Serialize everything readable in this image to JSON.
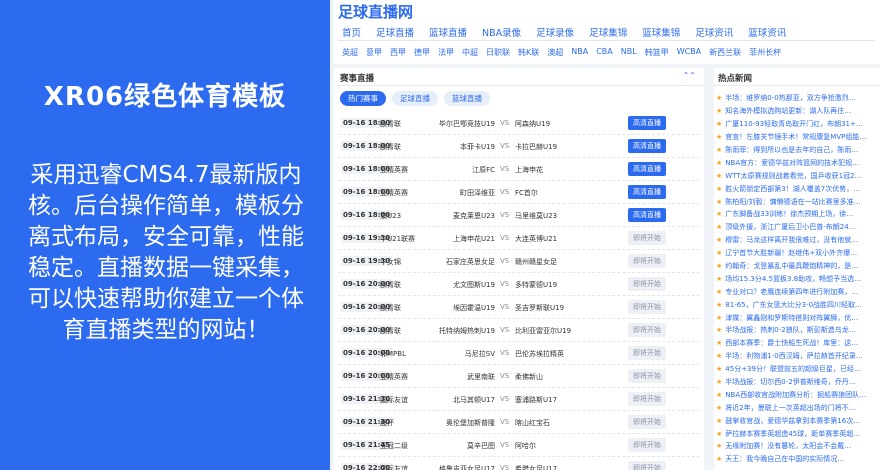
{
  "promo": {
    "title": "XR06绿色体育模板",
    "description": "采用迅睿CMS4.7最新版内核。后台操作简单，模板分离式布局，安全可靠，性能稳定。直播数据一键采集，可以快速帮助你建立一个体育直播类型的网站！"
  },
  "site": {
    "logo": "足球直播网",
    "nav_main": [
      "首页",
      "足球直播",
      "篮球直播",
      "NBA录像",
      "足球录像",
      "足球集锦",
      "篮球集锦",
      "足球资讯",
      "篮球资讯"
    ],
    "nav_sub": [
      "英超",
      "意甲",
      "西甲",
      "德甲",
      "法甲",
      "中超",
      "日职联",
      "韩K联",
      "澳超",
      "NBA",
      "CBA",
      "NBL",
      "韩篮甲",
      "WCBA",
      "新西兰联",
      "菲州长杯"
    ]
  },
  "schedule": {
    "title": "赛事直播",
    "collapse_icon": "double-chevron-up-icon",
    "tabs": [
      "热门赛事",
      "足球直播",
      "篮球直播"
    ],
    "rows": [
      {
        "time": "09-16 18:00",
        "league": "欧青联",
        "home": "毕尔巴鄂竞技U19",
        "vs": "VS",
        "away": "阿森纳U19",
        "button": "高清直播",
        "live": true
      },
      {
        "time": "09-16 18:00",
        "league": "欧青联",
        "home": "本菲卡U19",
        "vs": "VS",
        "away": "卡拉巴赫U19",
        "button": "高清直播",
        "live": true
      },
      {
        "time": "09-16 18:00",
        "league": "亚精英赛",
        "home": "江原FC",
        "vs": "VS",
        "away": "上海申花",
        "button": "高清直播",
        "live": true
      },
      {
        "time": "09-16 18:00",
        "league": "亚精英赛",
        "home": "町田泽维亚",
        "vs": "VS",
        "away": "FC首尔",
        "button": "高清直播",
        "live": true
      },
      {
        "time": "09-16 18:00",
        "league": "澳U23",
        "home": "麦克莱恩U23",
        "vs": "VS",
        "away": "马里维莫U23",
        "button": "高清直播",
        "live": true
      },
      {
        "time": "09-16 19:30",
        "league": "中U21联赛",
        "home": "上海申花U21",
        "vs": "VS",
        "away": "大连英博U21",
        "button": "即将开始",
        "live": false
      },
      {
        "time": "09-16 19:30",
        "league": "中女锦",
        "home": "石家庄英思女足",
        "vs": "VS",
        "away": "赣州赣星女足",
        "button": "即将开始",
        "live": false
      },
      {
        "time": "09-16 20:00",
        "league": "欧青联",
        "home": "尤文图斯U19",
        "vs": "VS",
        "away": "多特蒙德U19",
        "button": "即将开始",
        "live": false
      },
      {
        "time": "09-16 20:00",
        "league": "欧青联",
        "home": "埃因霍温U19",
        "vs": "VS",
        "away": "圣吉罗斯联U19",
        "button": "即将开始",
        "live": false
      },
      {
        "time": "09-16 20:00",
        "league": "欧青联",
        "home": "托特纳姆热刺U19",
        "vs": "VS",
        "away": "比利亚雷亚尔U19",
        "button": "即将开始",
        "live": false
      },
      {
        "time": "09-16 20:00",
        "league": "菲MPBL",
        "home": "马尼拉SV",
        "vs": "VS",
        "away": "巴伦苏埃拉精英",
        "button": "即将开始",
        "live": false
      },
      {
        "time": "09-16 20:00",
        "league": "亚精英赛",
        "home": "武里南联",
        "vs": "VS",
        "away": "柔佛新山",
        "button": "即将开始",
        "live": false
      },
      {
        "time": "09-16 21:30",
        "league": "国际友谊",
        "home": "北马其顿U17",
        "vs": "VS",
        "away": "塞浦路斯U17",
        "button": "即将开始",
        "live": false
      },
      {
        "time": "09-16 21:30",
        "league": "鹿杯",
        "home": "奥伦堡加斯普隆",
        "vs": "VS",
        "away": "喀山红宝石",
        "button": "即将开始",
        "live": false
      },
      {
        "time": "09-16 21:45",
        "league": "亚冠二级",
        "home": "莫辛巴图",
        "vs": "VS",
        "away": "阿哈尔",
        "button": "即将开始",
        "live": false
      },
      {
        "time": "09-16 22:00",
        "league": "国际友谊",
        "home": "格鲁吉亚女足U17",
        "vs": "VS",
        "away": "希腊女足U17",
        "button": "即将开始",
        "live": false
      }
    ]
  },
  "news": {
    "title": "热点新闻",
    "items": [
      "半场：维罗纳0-0热那亚，双方争抢激烈…",
      "知名海外模拟选购站更新：湖人队再往…",
      "广厦110-93轻取青岛取开门红，布朗31+…",
      "官宣！左膝关节镜手术！常规康复MVP组能…",
      "陈雨菲：得到所以也是去年的自己，陈雨…",
      "NBA官方：爱德华兹对阵篮网的技术犯规…",
      "WTT太原赛规则战着看完，国乒收获1冠2…",
      "胜火箭锁定西部第3！湖人覆盖7次优势，…",
      "陈柏阳/刘毅：慵懒德语在一站比赛里多准…",
      "广东脚备战33训练！徐杰预期上场，徐…",
      "顶级外援，浙江广厦后卫小巴普-布朗24…",
      "穆雷：马龙这样离开我很难过，没有他就…",
      "辽宁首节大胜新疆！赵继伟+双小外齐爆…",
      "约翰奇：戈登暴乱中最具鞭炮精神的，是…",
      "场均15.3分4.5篮板3.8助攻，畅想予当选…",
      "专业对口？老鹰连续第四年进行附加赛，…",
      "81-65，广东女篮大比分3-0战胜四川轻取…",
      "津媒：翼鑫刚和罗斯特搭则对阵翼狮，优…",
      "半场战报：热刺0-2狼队，斯彭斯造乌龙…",
      "西部本赛季：爵士快船生死战！库里：这…",
      "半场：利物浦1-0西汉姆，萨拉赫首开纪录…",
      "45分+39分！联盟前五的超级巨星，已经…",
      "半场战报：切尔西0-2伊普斯维奇，乔丹…",
      "NBA西部收官战附加赛分析：掘船赛狼团队…",
      "将近2年，曼联上一次英超出场的门将不…",
      "鼓掌收官战，爱德华兹拿到本赛季第16次…",
      "萨拉赫本赛季英超造45球，距单赛季英超…",
      "无缘附加赛！没有篡轮，太阳会不会戴…",
      "天王：我今晚自己在中国的实际情况…"
    ]
  }
}
